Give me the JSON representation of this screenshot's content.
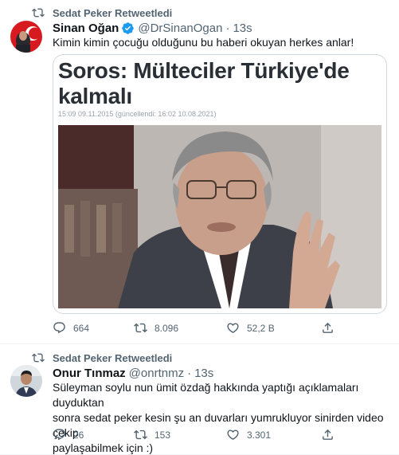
{
  "tweets": [
    {
      "retweeted_by": "Sedat Peker Retweetledi",
      "author_name": "Sinan Oğan",
      "verified": true,
      "handle": "@DrSinanOgan",
      "separator": "·",
      "time": "13s",
      "text": "Kimin kimin çocuğu olduğunu bu haberi okuyan herkes anlar!",
      "card": {
        "headline": "Soros: Mülteciler Türkiye'de kalmalı",
        "date_line": "15:09 09.11.2015 (güncellendi: 16:02 10.08.2021)"
      },
      "counts": {
        "replies": "664",
        "retweets": "8.096",
        "likes": "52,2 B"
      }
    },
    {
      "retweeted_by": "Sedat Peker Retweetledi",
      "author_name": "Onur Tınmaz",
      "verified": false,
      "handle": "@onrtnmz",
      "separator": "·",
      "time": "13s",
      "text_lines": [
        "Süleyman soylu nun ümit özdağ hakkında yaptığı açıklamaları duyduktan",
        "sonra sedat peker kesin şu an duvarları yumrukluyor sinirden video çekip",
        "paylaşabilmek için :)"
      ],
      "counts": {
        "replies": "26",
        "retweets": "153",
        "likes": "3.301"
      }
    }
  ],
  "colors": {
    "text": "#0f1419",
    "secondary": "#536471",
    "verified": "#1d9bf0",
    "border": "#cfd9de"
  },
  "icons": [
    "retweet-icon",
    "verified-badge-icon",
    "reply-icon",
    "retweet-icon",
    "like-icon",
    "share-icon"
  ]
}
